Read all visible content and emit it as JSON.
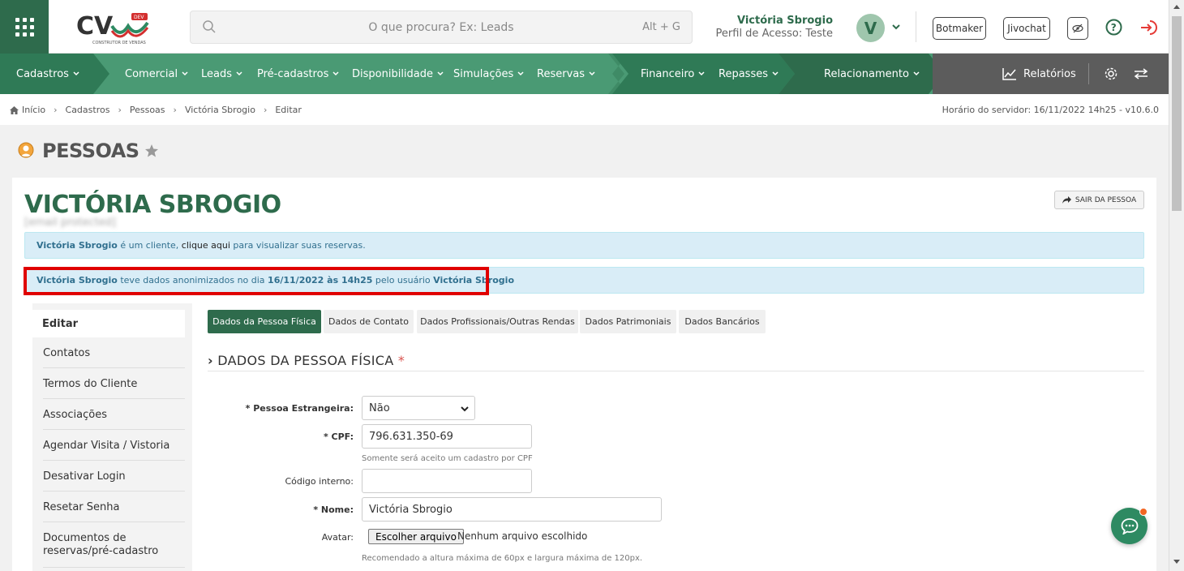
{
  "header": {
    "search_placeholder": "O que procura? Ex: Leads",
    "search_shortcut": "Alt + G",
    "user_name": "Victória Sbrogio",
    "user_profile": "Perfil de Acesso: Teste",
    "avatar_letter": "V",
    "botmaker": "Botmaker",
    "jivochat": "Jivochat"
  },
  "nav": {
    "cadastros": "Cadastros",
    "comercial": "Comercial",
    "leads": "Leads",
    "pre_cadastros": "Pré-cadastros",
    "disponibilidade": "Disponibilidade",
    "simulacoes": "Simulações",
    "reservas": "Reservas",
    "financeiro": "Financeiro",
    "repasses": "Repasses",
    "relacionamento": "Relacionamento",
    "relatorios": "Relatórios"
  },
  "breadcrumb": {
    "items": [
      "Início",
      "Cadastros",
      "Pessoas",
      "Victória Sbrogio",
      "Editar"
    ],
    "server_time": "Horário do servidor: 16/11/2022 14h25 - v10.6.0"
  },
  "page": {
    "title": "PESSOAS",
    "person_name": "VICTÓRIA SBROGIO",
    "person_email": "[email protected]",
    "exit_button": "SAIR DA PESSOA"
  },
  "alerts": {
    "a1_name": "Victória Sbrogio",
    "a1_text1": " é um cliente, ",
    "a1_link": "clique aqui",
    "a1_text2": " para visualizar suas reservas.",
    "a2_name": "Victória Sbrogio",
    "a2_text1": " teve dados anonimizados no dia ",
    "a2_date": "16/11/2022 às 14h25",
    "a2_text2": " pelo usuário ",
    "a2_user": "Victória Sbrogio"
  },
  "sidebar": {
    "active": "Editar",
    "items": [
      "Contatos",
      "Termos do Cliente",
      "Associações",
      "Agendar Visita / Vistoria",
      "Desativar Login",
      "Resetar Senha",
      "Documentos de reservas/pré-cadastro"
    ]
  },
  "tabs": [
    "Dados da Pessoa Física",
    "Dados de Contato",
    "Dados Profissionais/Outras Rendas",
    "Dados Patrimoniais",
    "Dados Bancários"
  ],
  "section": {
    "title": "DADOS DA PESSOA FÍSICA",
    "required_mark": "*"
  },
  "form": {
    "estrangeira_label": "* Pessoa Estrangeira:",
    "estrangeira_value": "Não",
    "cpf_label": "* CPF:",
    "cpf_value": "796.631.350-69",
    "cpf_help": "Somente será aceito um cadastro por CPF",
    "codigo_label": "Código interno:",
    "codigo_value": "",
    "nome_label": "* Nome:",
    "nome_value": "Victória Sbrogio",
    "avatar_label": "Avatar:",
    "file_button": "Escolher arquivo",
    "file_none": "Nenhum arquivo escolhido",
    "avatar_help": "Recomendado a altura máxima de 60px e largura máxima de 120px."
  },
  "colors": {
    "brand_dark": "#2e6b4c",
    "brand_nav": "#4a9a74",
    "alert_bg": "#d9edf7",
    "highlight": "#e00000"
  }
}
